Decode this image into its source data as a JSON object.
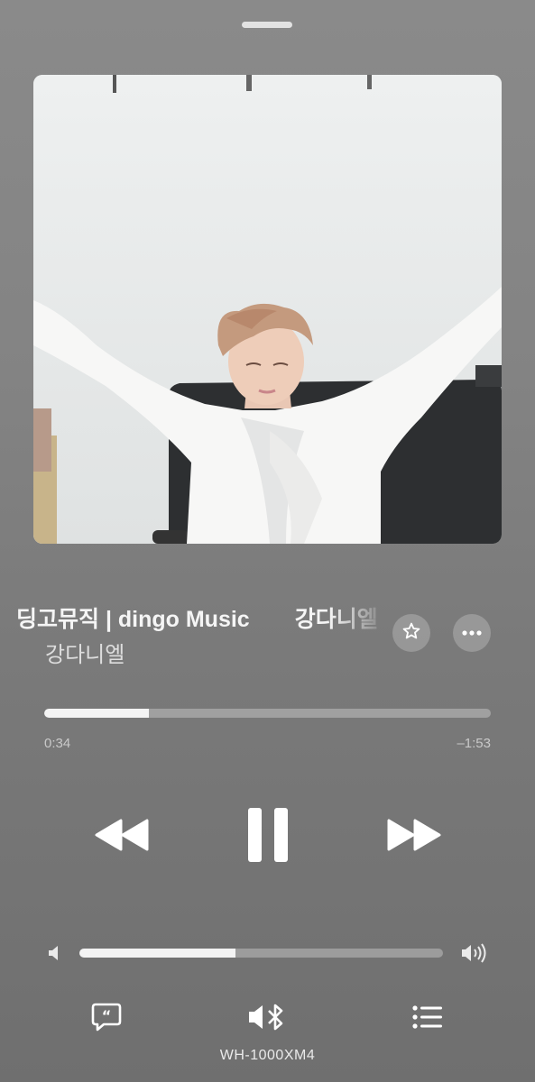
{
  "player": {
    "title": "딩고뮤직 | dingo Music",
    "title_repeat": "강다니엘",
    "artist": "강다니엘",
    "elapsed": "0:34",
    "remaining": "–1:53",
    "progress": 0.235,
    "volume": 0.43,
    "output_device": "WH-1000XM4"
  },
  "icons": {
    "favorite": "star-icon",
    "more": "ellipsis-icon",
    "rewind": "rewind-icon",
    "pause": "pause-icon",
    "forward": "fast-forward-icon",
    "volume_low": "speaker-low-icon",
    "volume_high": "speaker-high-icon",
    "lyrics": "lyrics-bubble-icon",
    "output": "bluetooth-speaker-icon",
    "queue": "queue-list-icon"
  }
}
